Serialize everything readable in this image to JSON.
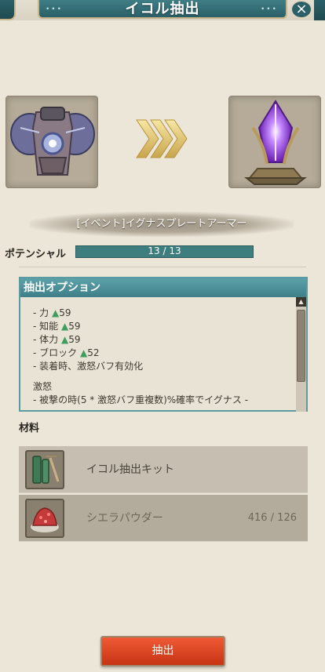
{
  "header": {
    "title": "イコル抽出",
    "close_icon": "close-icon"
  },
  "item": {
    "name": "[イベント]イグナスプレートアーマー",
    "source_icon": "armor-icon",
    "result_icon": "crystal-icon"
  },
  "potential": {
    "label": "ポテンシャル",
    "value": "13 / 13",
    "fill": 1.0
  },
  "options": {
    "title": "抽出オプション",
    "lines": [
      {
        "label": "- 力",
        "value": "59",
        "up": true
      },
      {
        "label": "- 知能",
        "value": "59",
        "up": true
      },
      {
        "label": "- 体力",
        "value": "59",
        "up": true
      },
      {
        "label": "- ブロック",
        "value": "52",
        "up": true
      },
      {
        "label": "- 装着時、激怒バフ有効化",
        "value": "",
        "up": false
      }
    ],
    "section_title": "激怒",
    "section_text": "- 被撃の時(5 * 激怒バフ重複数)%確率でイグナス -"
  },
  "materials": {
    "label": "材料",
    "items": [
      {
        "name": "イコル抽出キット",
        "count": "",
        "icon": "extract-kit-icon"
      },
      {
        "name": "シエラパウダー",
        "count": "416 / 126",
        "icon": "powder-icon"
      }
    ]
  },
  "extract_button": {
    "label": "抽出"
  },
  "colors": {
    "accent": "#3e7f88",
    "button": "#e24a25"
  }
}
